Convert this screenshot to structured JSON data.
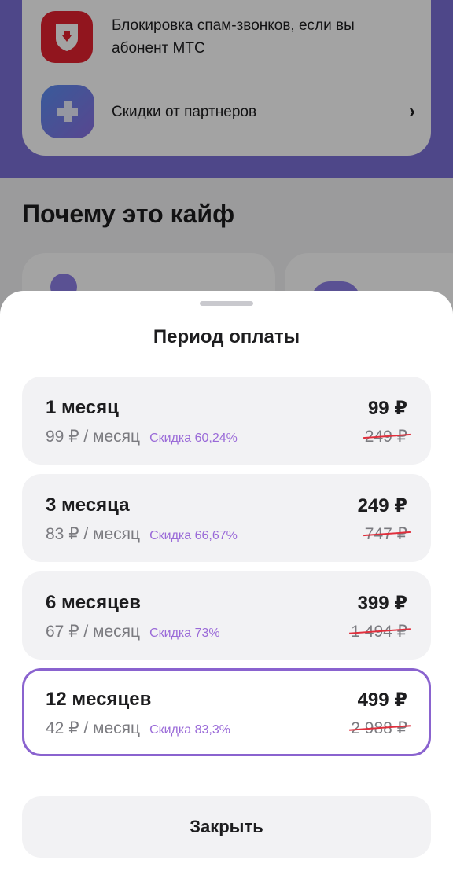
{
  "background": {
    "features": [
      {
        "icon": "shield-phone-icon",
        "text": "Блокировка спам-звонков, если вы абонент МТС"
      },
      {
        "icon": "partners-discount-icon",
        "text": "Скидки от партнеров"
      }
    ],
    "section_title": "Почему это кайф",
    "colors": {
      "band": "#7b6fd6",
      "red_icon": "#e3212f"
    }
  },
  "sheet": {
    "title": "Период оплаты",
    "plans": [
      {
        "name": "1 месяц",
        "price": "99 ₽",
        "per_month": "99 ₽ / месяц",
        "discount": "Скидка 60,24%",
        "old_price": "249 ₽",
        "selected": false
      },
      {
        "name": "3 месяца",
        "price": "249 ₽",
        "per_month": "83 ₽ / месяц",
        "discount": "Скидка 66,67%",
        "old_price": "747 ₽",
        "selected": false
      },
      {
        "name": "6 месяцев",
        "price": "399 ₽",
        "per_month": "67 ₽ / месяц",
        "discount": "Скидка 73%",
        "old_price": "1 494 ₽",
        "selected": false
      },
      {
        "name": "12 месяцев",
        "price": "499 ₽",
        "per_month": "42 ₽ / месяц",
        "discount": "Скидка 83,3%",
        "old_price": "2 988 ₽",
        "selected": true
      }
    ],
    "close_label": "Закрыть",
    "colors": {
      "accent": "#8a63cf",
      "discount": "#9a6ad8",
      "strike": "#e0303d"
    }
  }
}
